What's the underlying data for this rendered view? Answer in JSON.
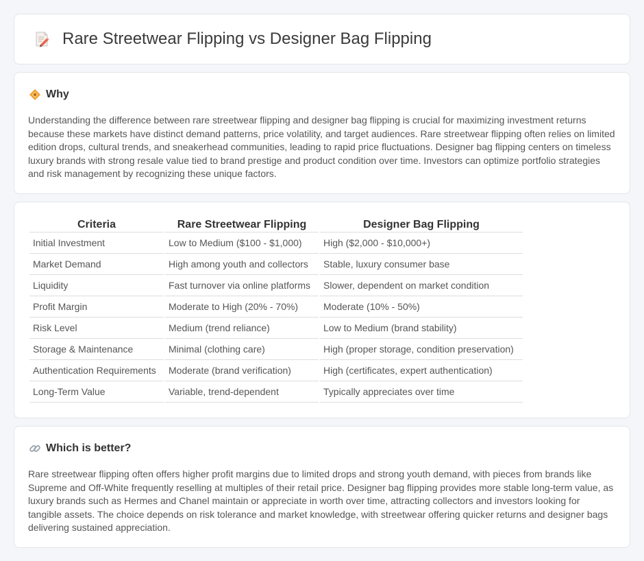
{
  "header": {
    "title": "Rare Streetwear Flipping vs Designer Bag Flipping",
    "icon": "memo-pencil-icon"
  },
  "why": {
    "title": "Why",
    "icon": "diamond-orange-icon",
    "text": "Understanding the difference between rare streetwear flipping and designer bag flipping is crucial for maximizing investment returns because these markets have distinct demand patterns, price volatility, and target audiences. Rare streetwear flipping often relies on limited edition drops, cultural trends, and sneakerhead communities, leading to rapid price fluctuations. Designer bag flipping centers on timeless luxury brands with strong resale value tied to brand prestige and product condition over time. Investors can optimize portfolio strategies and risk management by recognizing these unique factors."
  },
  "table": {
    "headers": [
      "Criteria",
      "Rare Streetwear Flipping",
      "Designer Bag Flipping"
    ],
    "rows": [
      [
        "Initial Investment",
        "Low to Medium ($100 - $1,000)",
        "High ($2,000 - $10,000+)"
      ],
      [
        "Market Demand",
        "High among youth and collectors",
        "Stable, luxury consumer base"
      ],
      [
        "Liquidity",
        "Fast turnover via online platforms",
        "Slower, dependent on market condition"
      ],
      [
        "Profit Margin",
        "Moderate to High (20% - 70%)",
        "Moderate (10% - 50%)"
      ],
      [
        "Risk Level",
        "Medium (trend reliance)",
        "Low to Medium (brand stability)"
      ],
      [
        "Storage & Maintenance",
        "Minimal (clothing care)",
        "High (proper storage, condition preservation)"
      ],
      [
        "Authentication Requirements",
        "Moderate (brand verification)",
        "High (certificates, expert authentication)"
      ],
      [
        "Long-Term Value",
        "Variable, trend-dependent",
        "Typically appreciates over time"
      ]
    ]
  },
  "better": {
    "title": "Which is better?",
    "icon": "link-icon",
    "text": "Rare streetwear flipping often offers higher profit margins due to limited drops and strong youth demand, with pieces from brands like Supreme and Off-White frequently reselling at multiples of their retail price. Designer bag flipping provides more stable long-term value, as luxury brands such as Hermes and Chanel maintain or appreciate in worth over time, attracting collectors and investors looking for tangible assets. The choice depends on risk tolerance and market knowledge, with streetwear offering quicker returns and designer bags delivering sustained appreciation."
  }
}
